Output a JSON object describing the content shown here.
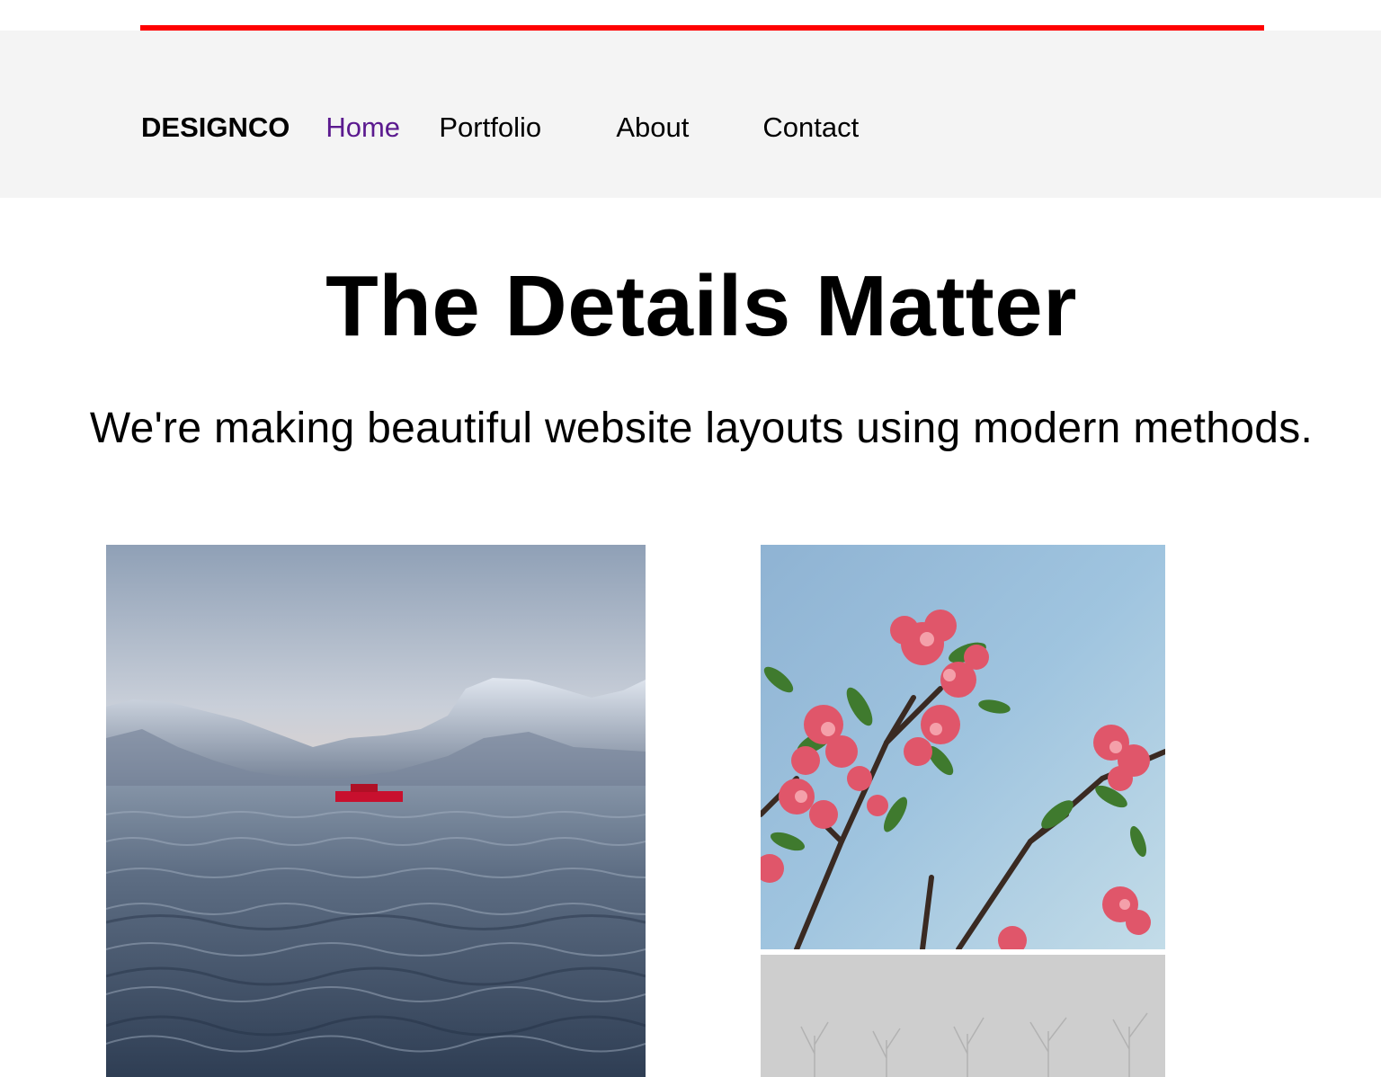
{
  "nav": {
    "brand": "DESIGNCO",
    "links": [
      {
        "label": "Home",
        "active": true
      },
      {
        "label": "Portfolio",
        "active": false
      },
      {
        "label": "About",
        "active": false
      },
      {
        "label": "Contact",
        "active": false
      }
    ],
    "active_color": "#5b1a8f"
  },
  "hero": {
    "title": "The Details Matter",
    "subtitle": "We're making beautiful website layouts using modern methods."
  },
  "colors": {
    "accent_line": "#ff0000",
    "nav_background": "#f4f4f4"
  },
  "gallery": [
    {
      "subject": "snowy-mountains-sea-red-boat"
    },
    {
      "subject": "pink-flowers-blue-sky"
    },
    {
      "subject": "foggy-trees-grayscale"
    }
  ]
}
